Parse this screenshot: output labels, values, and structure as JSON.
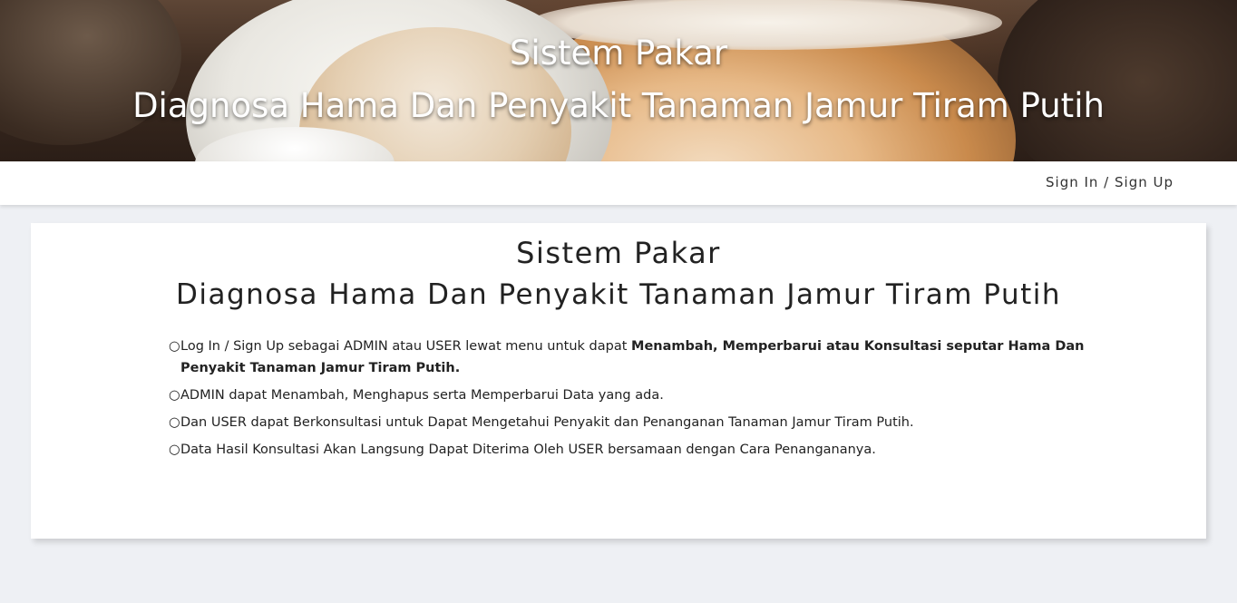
{
  "hero": {
    "title": "Sistem Pakar",
    "subtitle": "Diagnosa Hama Dan Penyakit Tanaman Jamur Tiram Putih"
  },
  "navbar": {
    "signin_label": "Sign In / Sign Up"
  },
  "card": {
    "title": "Sistem Pakar",
    "subtitle": "Diagnosa Hama Dan Penyakit Tanaman Jamur Tiram Putih",
    "bullet_symbol": "○",
    "items": [
      {
        "text": "Log In / Sign Up sebagai ADMIN atau USER lewat menu untuk dapat ",
        "bold": "Menambah, Memperbarui atau Konsultasi seputar Hama Dan Penyakit Tanaman Jamur Tiram Putih."
      },
      {
        "text": "ADMIN dapat Menambah, Menghapus serta Memperbarui Data yang ada."
      },
      {
        "text": "Dan USER dapat Berkonsultasi untuk Dapat Mengetahui Penyakit dan Penanganan Tanaman Jamur Tiram Putih."
      },
      {
        "text": "Data Hasil Konsultasi Akan Langsung Dapat Diterima Oleh USER bersamaan dengan Cara Penangananya."
      }
    ]
  },
  "colors": {
    "page_background": "#eef0f4",
    "card_background": "#ffffff",
    "text": "#222222",
    "hero_text": "#ffffff"
  }
}
